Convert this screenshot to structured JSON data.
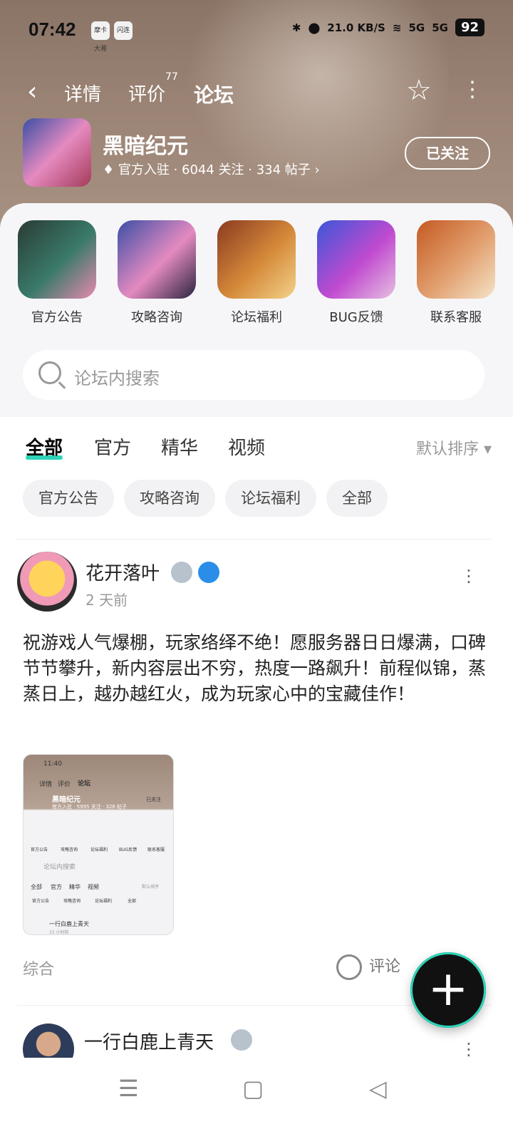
{
  "status_bar": {
    "time": "07:42",
    "app_icons": [
      "摩卡大哥",
      "闪连"
    ],
    "net_speed": "21.0 KB/S",
    "signal_labels": [
      "5G",
      "5G"
    ],
    "battery": "92"
  },
  "nav": {
    "tabs": [
      {
        "label": "详情"
      },
      {
        "label": "评价",
        "badge": "77"
      },
      {
        "label": "论坛"
      }
    ],
    "active_tab": "论坛"
  },
  "game": {
    "name": "黑暗纪元",
    "meta": "官方入驻 · 6044 关注 · 334 帖子",
    "follow_label": "已关注"
  },
  "categories": [
    {
      "label": "官方公告",
      "color": "#3a7a6a"
    },
    {
      "label": "攻略咨询",
      "color": "#e48ac0"
    },
    {
      "label": "论坛福利",
      "color": "#d58a3a"
    },
    {
      "label": "BUG反馈",
      "color": "#5a6ad8"
    },
    {
      "label": "联系客服",
      "color": "#d9772f"
    }
  ],
  "search": {
    "placeholder": "论坛内搜索"
  },
  "filter_tabs": [
    "全部",
    "官方",
    "精华",
    "视频"
  ],
  "sort_label": "默认排序",
  "chips": [
    "官方公告",
    "攻略咨询",
    "论坛福利",
    "全部"
  ],
  "post": {
    "author": "花开落叶",
    "time": "2 天前",
    "body": "祝游戏人气爆棚，玩家络绎不绝！愿服务器日日爆满，口碑节节攀升，新内容层出不穷，热度一路飙升！前程似锦，蒸蒸日上，越办越红火，成为玩家心中的宝藏佳作！",
    "thumbnail": {
      "time": "11:40",
      "tabs": [
        "详情",
        "评价",
        "论坛"
      ],
      "game_name": "黑暗纪元",
      "follow": "已关注",
      "meta": "官方入驻 · 5995 关注 · 328 帖子",
      "cats": [
        "官方公告",
        "攻略咨询",
        "论坛福利",
        "BUG反馈",
        "联系客服"
      ],
      "search": "论坛内搜索",
      "filter_tabs": [
        "全部",
        "官方",
        "精华",
        "视频"
      ],
      "sort": "默认排序",
      "chips": [
        "官方公告",
        "攻略咨询",
        "论坛福利",
        "全部"
      ],
      "post_author": "一行白鹿上青天",
      "post_time": "15 小时前"
    },
    "footer_label": "综合",
    "comment_label": "评论"
  },
  "post2": {
    "author": "一行白鹿上青天"
  },
  "accent_color": "#2dd4b8"
}
